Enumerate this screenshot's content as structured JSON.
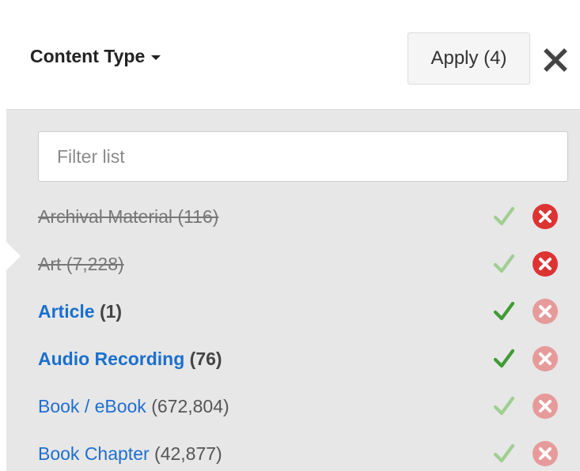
{
  "header": {
    "title": "Content Type",
    "apply_label": "Apply (4)",
    "close_glyph": "✕"
  },
  "filter": {
    "placeholder": "Filter list",
    "value": ""
  },
  "colors": {
    "link_blue": "#1f6fd0",
    "check_active": "#3f9b34",
    "check_inactive": "#9fcf92",
    "exclude_active": "#dd3333",
    "exclude_inactive": "#e79a9a",
    "list_background": "#e7e7e7"
  },
  "items": [
    {
      "name": "Archival Material",
      "count": "(116)",
      "state": "excluded"
    },
    {
      "name": "Art",
      "count": "(7,228)",
      "state": "excluded"
    },
    {
      "name": "Article",
      "count": "(1)",
      "state": "selected"
    },
    {
      "name": "Audio Recording",
      "count": "(76)",
      "state": "selected"
    },
    {
      "name": "Book / eBook",
      "count": "(672,804)",
      "state": "normal"
    },
    {
      "name": "Book Chapter",
      "count": "(42,877)",
      "state": "normal"
    }
  ]
}
